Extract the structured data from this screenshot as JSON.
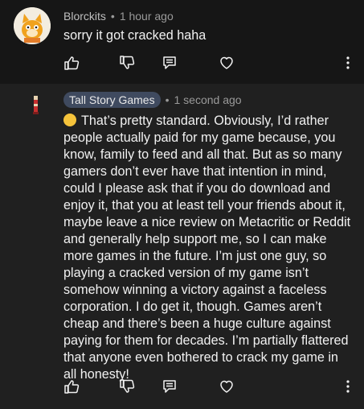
{
  "comments": [
    {
      "author": "Blorckits",
      "time": "1 hour ago",
      "text": "sorry it got cracked haha"
    },
    {
      "author": "Tall Story Games",
      "time": "1 second ago",
      "text": "That’s pretty standard. Obviously, I’d rather people actually paid for my game because, you know, family to feed and all that. But as so many gamers don’t ever have that intention in mind, could I please ask that if you do download and enjoy it, that you at least tell your friends about it, maybe leave a nice review on Metacritic or Reddit and generally help support me, so I can make more games in the future. I’m just one guy, so playing a cracked version of my game isn’t somehow winning a victory against a faceless corporation. I do get it, though. Games aren’t cheap and there’s been a huge culture against paying for them for decades. I’m partially flattered that anyone even bothered to crack my game in all honesty!"
    }
  ],
  "separator": "•",
  "icons": {
    "like": "thumbs-up-icon",
    "dislike": "thumbs-down-icon",
    "reply": "reply-icon",
    "heart": "heart-icon",
    "more": "more-vert-icon"
  },
  "colors": {
    "background": "#161616",
    "reply_background": "#202020",
    "badge": "#3f4a5f",
    "meta": "#9a9a9a"
  }
}
